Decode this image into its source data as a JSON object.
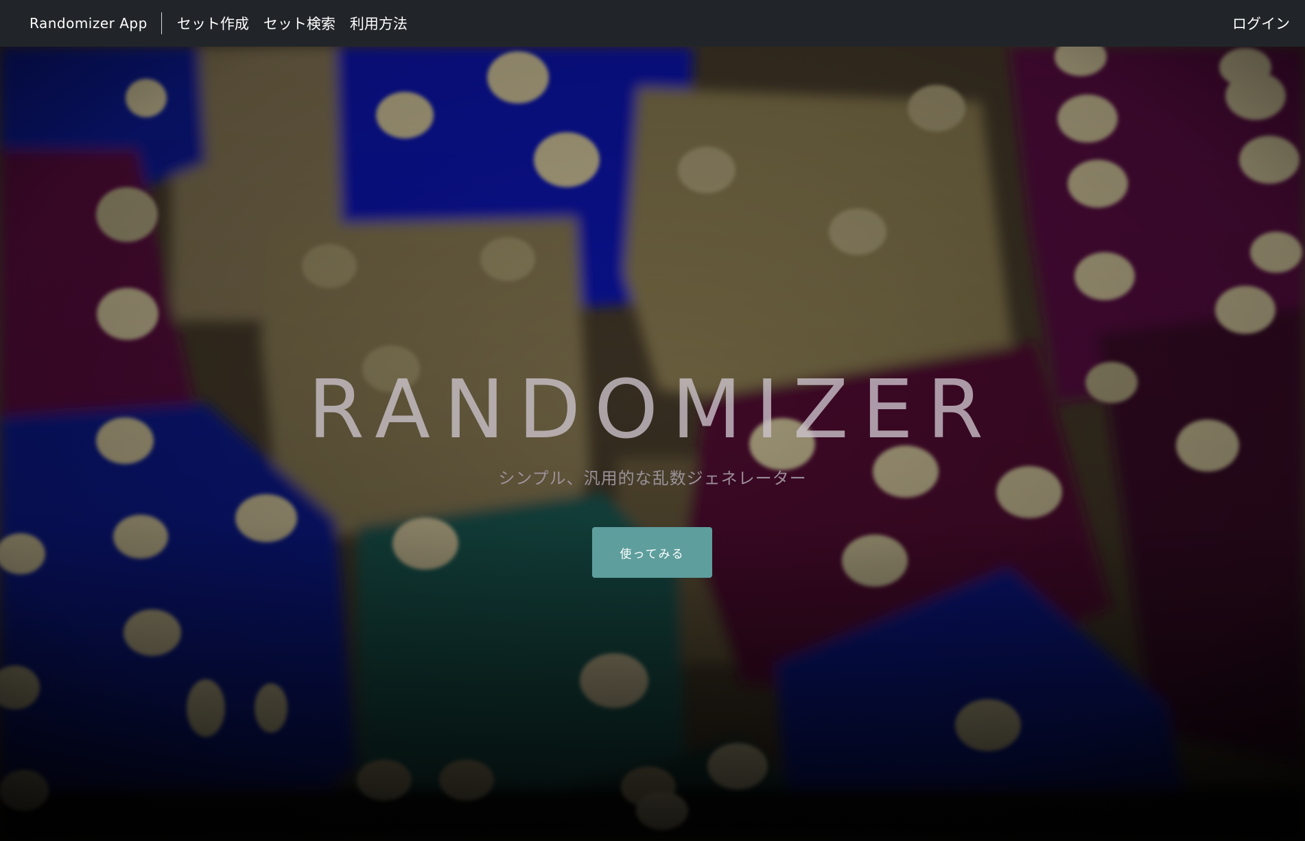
{
  "navbar": {
    "brand": "Randomizer App",
    "links": [
      {
        "label": "セット作成"
      },
      {
        "label": "セット検索"
      },
      {
        "label": "利用方法"
      }
    ],
    "login": "ログイン"
  },
  "hero": {
    "title": "RANDOMIZER",
    "subtitle": "シンプル、汎用的な乱数ジェネレーター",
    "cta_label": "使ってみる",
    "background": "blurred-dice-photo"
  },
  "colors": {
    "navbar_bg": "#212529",
    "cta_bg": "#5e9e9d",
    "dice_blue": "#0a14a8",
    "dice_purple": "#5a0a3c",
    "dice_clear": "#8c7e52",
    "dice_teal": "#1f5a52"
  }
}
